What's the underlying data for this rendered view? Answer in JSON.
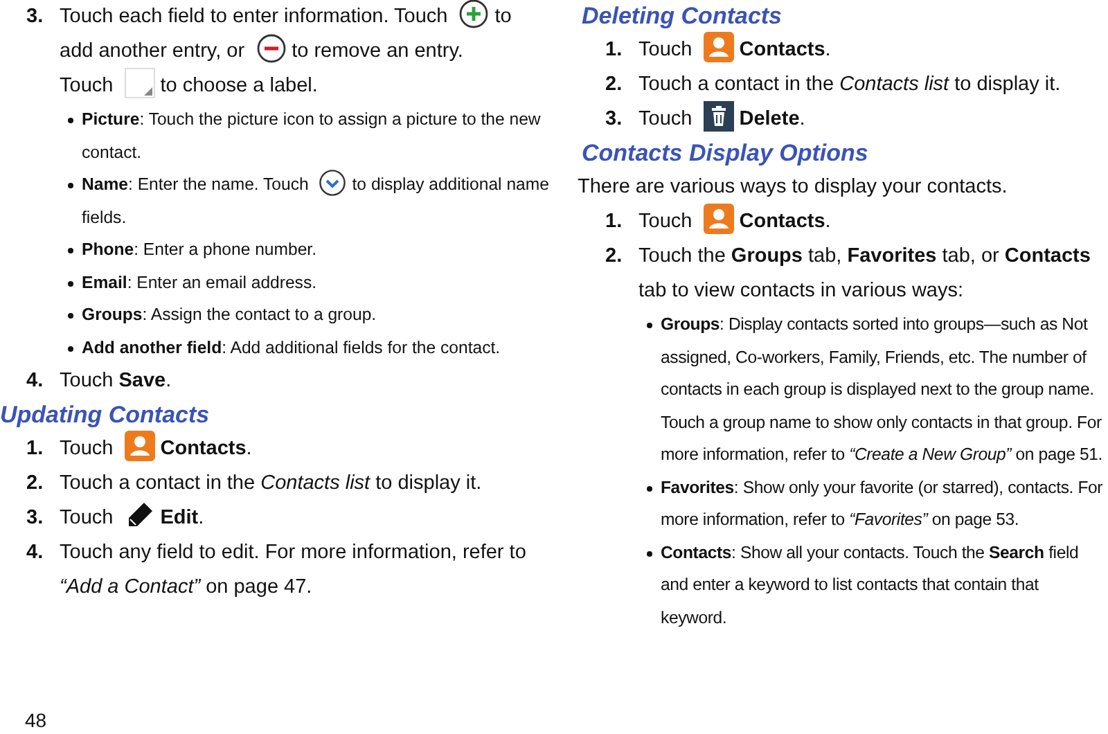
{
  "columns": [
    {
      "blocks": [
        {
          "kind": "step",
          "number": "3.",
          "parts": [
            {
              "kind": "text",
              "text": "Touch each field to enter information. Touch"
            },
            {
              "kind": "plus"
            },
            {
              "kind": "text",
              "text": "to"
            },
            {
              "kind": "break"
            },
            {
              "kind": "text",
              "text": "add another entry, or"
            },
            {
              "kind": "minus"
            },
            {
              "kind": "text",
              "text": "to remove an entry."
            },
            {
              "kind": "break"
            },
            {
              "kind": "text",
              "text": "Touch"
            },
            {
              "kind": "dropdown"
            },
            {
              "kind": "text",
              "text": "to choose a label."
            }
          ],
          "children": [
            {
              "parts": [
                {
                  "kind": "text",
                  "text": "**Picture**: Touch the picture icon to assign a picture to the new contact."
                }
              ]
            },
            {
              "parts": [
                {
                  "kind": "text",
                  "text": "**Name**: Enter the name. Touch"
                },
                {
                  "kind": "chevron"
                },
                {
                  "kind": "text",
                  "text": "to display additional name"
                },
                {
                  "kind": "break"
                },
                {
                  "kind": "text",
                  "text": "fields."
                }
              ]
            },
            {
              "parts": [
                {
                  "kind": "text",
                  "text": "**Phone**: Enter a phone number."
                }
              ]
            },
            {
              "parts": [
                {
                  "kind": "text",
                  "text": "**Email**: Enter an email address."
                }
              ]
            },
            {
              "parts": [
                {
                  "kind": "text",
                  "text": "**Groups**: Assign the contact to a group."
                }
              ]
            },
            {
              "parts": [
                {
                  "kind": "text",
                  "text": "**Add another field**: Add additional fields for the contact."
                }
              ]
            }
          ]
        },
        {
          "kind": "step",
          "number": "4.",
          "parts": [
            {
              "kind": "text",
              "text": "Touch **Save**."
            }
          ]
        },
        {
          "kind": "heading",
          "text": "Updating Contacts"
        },
        {
          "kind": "step",
          "number": "1.",
          "parts": [
            {
              "kind": "text",
              "text": "Touch"
            },
            {
              "kind": "contacts"
            },
            {
              "kind": "text",
              "text": "**Contacts**."
            }
          ]
        },
        {
          "kind": "step",
          "number": "2.",
          "parts": [
            {
              "kind": "text",
              "text": "Touch a contact in the *Contacts list* to display it."
            }
          ]
        },
        {
          "kind": "step",
          "number": "3.",
          "parts": [
            {
              "kind": "text",
              "text": "Touch"
            },
            {
              "kind": "pencil"
            },
            {
              "kind": "text",
              "text": "**Edit**."
            }
          ]
        },
        {
          "kind": "step",
          "number": "4.",
          "parts": [
            {
              "kind": "text",
              "text": "Touch any field to edit. For more information, refer to *“Add a Contact”* on page 47."
            }
          ]
        }
      ],
      "page_number": "48"
    },
    {
      "blocks": [
        {
          "kind": "heading",
          "text": "Deleting Contacts"
        },
        {
          "kind": "step",
          "number": "1.",
          "parts": [
            {
              "kind": "text",
              "text": "Touch"
            },
            {
              "kind": "contacts"
            },
            {
              "kind": "text",
              "text": "**Contacts**."
            }
          ]
        },
        {
          "kind": "step",
          "number": "2.",
          "parts": [
            {
              "kind": "text",
              "text": "Touch a contact in the *Contacts list* to display it."
            }
          ]
        },
        {
          "kind": "step",
          "number": "3.",
          "parts": [
            {
              "kind": "text",
              "text": "Touch"
            },
            {
              "kind": "trash"
            },
            {
              "kind": "text",
              "text": "**Delete**."
            }
          ]
        },
        {
          "kind": "heading",
          "text": "Contacts Display Options"
        },
        {
          "kind": "para",
          "text": "There are various ways to display your contacts."
        },
        {
          "kind": "step",
          "number": "1.",
          "parts": [
            {
              "kind": "text",
              "text": "Touch"
            },
            {
              "kind": "contacts"
            },
            {
              "kind": "text",
              "text": "**Contacts**."
            }
          ]
        },
        {
          "kind": "step",
          "number": "2.",
          "parts": [
            {
              "kind": "text",
              "text": "Touch the **Groups** tab, **Favorites** tab, or **Contacts** tab to view contacts in various ways:"
            }
          ],
          "children": [
            {
              "parts": [
                {
                  "kind": "text",
                  "text": "**Groups**: Display contacts sorted into groups—such as Not assigned, Co-workers, Family, Friends, etc. The number of contacts in each group is displayed next to the group name. Touch a group name to show only contacts in that group. For more information, refer to *“Create a New Group”* on page 51."
                }
              ]
            },
            {
              "parts": [
                {
                  "kind": "text",
                  "text": "**Favorites**: Show only your favorite (or starred), contacts. For more information, refer to *“Favorites”* on page 53."
                }
              ]
            },
            {
              "parts": [
                {
                  "kind": "text",
                  "text": "**Contacts**: Show all your contacts. Touch the **Search** field and enter a keyword to list contacts that contain that keyword."
                }
              ]
            }
          ]
        }
      ]
    }
  ]
}
